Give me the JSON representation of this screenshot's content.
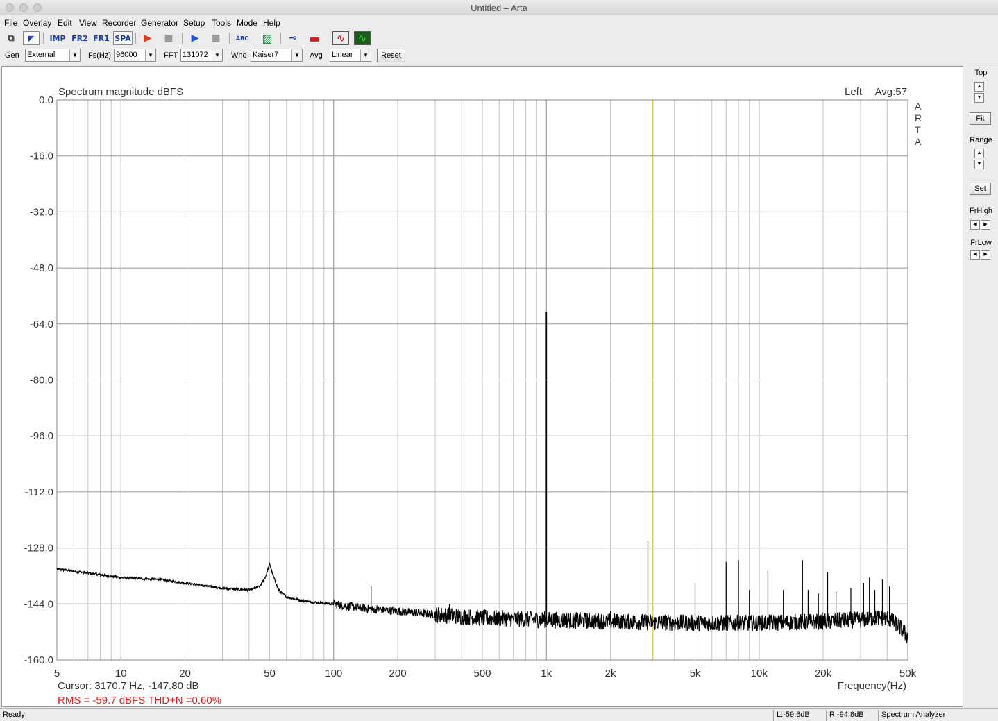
{
  "window": {
    "title": "Untitled – Arta"
  },
  "menu": [
    "File",
    "Overlay",
    "Edit",
    "View",
    "Recorder",
    "Generator",
    "Setup",
    "Tools",
    "Mode",
    "Help"
  ],
  "toolbar": {
    "buttons": [
      {
        "name": "copy-icon",
        "glyph": "⧉"
      },
      {
        "name": "pointer-icon",
        "glyph": "◤"
      },
      {
        "name": "imp-mode-icon",
        "glyph": "IMP"
      },
      {
        "name": "fr2-mode-icon",
        "glyph": "FR2"
      },
      {
        "name": "fr1-mode-icon",
        "glyph": "FR1"
      },
      {
        "name": "spa-mode-icon",
        "glyph": "SPA"
      },
      {
        "name": "record-icon",
        "glyph": "▶"
      },
      {
        "name": "stop-record-icon",
        "glyph": "■"
      },
      {
        "name": "play-icon",
        "glyph": "▶"
      },
      {
        "name": "stop-play-icon",
        "glyph": "■"
      },
      {
        "name": "abc-icon",
        "glyph": "ABC"
      },
      {
        "name": "hatch-icon",
        "glyph": "▨"
      },
      {
        "name": "key-icon",
        "glyph": "⊸"
      },
      {
        "name": "bar-icon",
        "glyph": "▬"
      },
      {
        "name": "sine-icon",
        "glyph": "∿"
      },
      {
        "name": "scope-icon",
        "glyph": "∿"
      }
    ]
  },
  "controls": {
    "gen_label": "Gen",
    "gen_value": "External",
    "fs_label": "Fs(Hz)",
    "fs_value": "96000",
    "fft_label": "FFT",
    "fft_value": "131072",
    "wnd_label": "Wnd",
    "wnd_value": "Kaiser7",
    "avg_label": "Avg",
    "avg_value": "Linear",
    "reset_label": "Reset"
  },
  "right_panel": {
    "top_label": "Top",
    "fit_label": "Fit",
    "range_label": "Range",
    "set_label": "Set",
    "frhigh_label": "FrHigh",
    "frlow_label": "FrLow"
  },
  "chart_data": {
    "type": "line",
    "title": "Spectrum magnitude dBFS",
    "channel": "Left",
    "avg_text": "Avg:57",
    "brand": "ARTA",
    "xlabel": "Frequency(Hz)",
    "x_scale": "log",
    "xlim": [
      5,
      50000
    ],
    "ylim": [
      -160,
      0
    ],
    "grid": true,
    "y_ticks": [
      "0.0",
      "-16.0",
      "-32.0",
      "-48.0",
      "-64.0",
      "-80.0",
      "-96.0",
      "-112.0",
      "-128.0",
      "-144.0",
      "-160.0"
    ],
    "y_tick_values": [
      0,
      -16,
      -32,
      -48,
      -64,
      -80,
      -96,
      -112,
      -128,
      -144,
      -160
    ],
    "x_ticks": [
      {
        "label": "5",
        "value": 5
      },
      {
        "label": "10",
        "value": 10
      },
      {
        "label": "20",
        "value": 20
      },
      {
        "label": "50",
        "value": 50
      },
      {
        "label": "100",
        "value": 100
      },
      {
        "label": "200",
        "value": 200
      },
      {
        "label": "500",
        "value": 500
      },
      {
        "label": "1k",
        "value": 1000
      },
      {
        "label": "2k",
        "value": 2000
      },
      {
        "label": "5k",
        "value": 5000
      },
      {
        "label": "10k",
        "value": 10000
      },
      {
        "label": "20k",
        "value": 20000
      },
      {
        "label": "50k",
        "value": 50000
      }
    ],
    "series": [
      {
        "noise_floor": {
          "x": [
            5,
            10,
            15,
            20,
            30,
            40,
            45,
            48,
            50,
            52,
            55,
            60,
            70,
            80,
            100,
            130,
            150,
            200,
            300,
            500,
            1000,
            2000,
            5000,
            10000,
            20000,
            30000,
            35000,
            40000,
            45000,
            50000
          ],
          "y": [
            -134,
            -136.5,
            -137,
            -138,
            -139.5,
            -140,
            -139,
            -136,
            -132.5,
            -136,
            -140,
            -142,
            -143,
            -143.5,
            -144,
            -145,
            -145.5,
            -146,
            -147,
            -148,
            -148.5,
            -149,
            -149.5,
            -149.5,
            -149,
            -148.5,
            -148,
            -148,
            -150,
            -153.5
          ]
        },
        "peaks": [
          {
            "x": 150,
            "y": -139
          },
          {
            "x": 350,
            "y": -144
          },
          {
            "x": 1000,
            "y": -60.5
          },
          {
            "x": 2000,
            "y": -146
          },
          {
            "x": 3000,
            "y": -126
          },
          {
            "x": 5000,
            "y": -138
          },
          {
            "x": 7000,
            "y": -132
          },
          {
            "x": 8000,
            "y": -131.5
          },
          {
            "x": 9000,
            "y": -140
          },
          {
            "x": 11000,
            "y": -134.5
          },
          {
            "x": 13000,
            "y": -140
          },
          {
            "x": 16000,
            "y": -131.5
          },
          {
            "x": 17000,
            "y": -140
          },
          {
            "x": 19000,
            "y": -141
          },
          {
            "x": 21000,
            "y": -135
          },
          {
            "x": 23000,
            "y": -140.5
          },
          {
            "x": 27000,
            "y": -139.5
          },
          {
            "x": 31000,
            "y": -138
          },
          {
            "x": 33000,
            "y": -136.5
          },
          {
            "x": 35000,
            "y": -140
          },
          {
            "x": 38000,
            "y": -137
          },
          {
            "x": 41000,
            "y": -139
          }
        ]
      }
    ],
    "cursor": {
      "x": 3170.7,
      "text": "Cursor:  3170.7 Hz, -147.80 dB"
    },
    "summary": {
      "text": "RMS =  -59.7 dBFS   THD+N =0.60%",
      "color": "#e02020"
    },
    "colors": {
      "trace": "#000000",
      "cursor": "#d4b800",
      "grid": "#a0a0a0"
    }
  },
  "status": {
    "ready": "Ready",
    "left": "L:-59.6dB",
    "right": "R:-94.8dB",
    "mode": "Spectrum Analyzer"
  }
}
